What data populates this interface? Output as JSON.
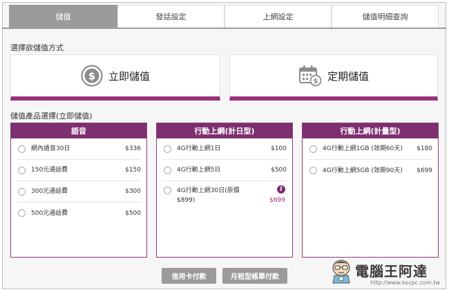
{
  "tabs": [
    {
      "label": "儲值",
      "active": true
    },
    {
      "label": "發話設定",
      "active": false
    },
    {
      "label": "上網設定",
      "active": false
    },
    {
      "label": "儲值明細查詢",
      "active": false
    }
  ],
  "method_section_label": "選擇欲儲值方式",
  "methods": [
    {
      "label": "立即儲值",
      "icon": "dollar-coin-icon"
    },
    {
      "label": "定期儲值",
      "icon": "calendar-money-icon"
    }
  ],
  "product_section_label": "儲值產品選擇(立即儲值)",
  "columns": [
    {
      "title": "語音",
      "items": [
        {
          "name": "網內語音30日",
          "price": "$336"
        },
        {
          "name": "150元通話費",
          "price": "$150"
        },
        {
          "name": "300元通話費",
          "price": "$300"
        },
        {
          "name": "500元通話費",
          "price": "$500"
        }
      ]
    },
    {
      "title": "行動上網(計日型)",
      "items": [
        {
          "name": "4G行動上網1日",
          "price": "$100"
        },
        {
          "name": "4G行動上網5日",
          "price": "$500"
        },
        {
          "name": "4G行動上網30日(原價 $899)",
          "price": "$699"
        }
      ]
    },
    {
      "title": "行動上網(計量型)",
      "items": [
        {
          "name": "4G行動上網1GB (效期60天)",
          "price": "$180"
        },
        {
          "name": "4G行動上網5GB (效期90天)",
          "price": "$699"
        }
      ]
    }
  ],
  "payment_buttons": {
    "credit_card": "信用卡付款",
    "monthly_bill": "月租型帳單付款"
  },
  "watermark": {
    "title": "電腦王阿達",
    "url": "http://www.kocpc.com.tw"
  },
  "colors": {
    "accent": "#7d2f70",
    "accent_bar": "#9b2f7e",
    "tab_active": "#9b9b9b"
  }
}
